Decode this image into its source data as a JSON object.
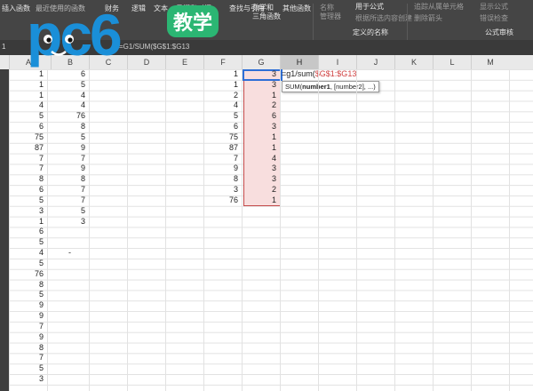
{
  "ribbon": {
    "insert_function": "插入函数",
    "recent": "最近使用的函数",
    "financial": "财务",
    "logical": "逻辑",
    "text": "文本",
    "datetime": "日期和时间",
    "lookup": "查找与引用",
    "math_trig": "数学和\n三角函数",
    "more": "其他函数",
    "name_manager": "名称\n管理器",
    "use_in_formula": "用于公式",
    "create_from_sel": "根据所选内容创建",
    "defined_names_group": "定义的名称",
    "trace_dependents": "追踪从属单元格",
    "remove_arrows": "删除箭头",
    "show_formulas": "显示公式",
    "error_check": "错误检查",
    "formula_audit_group": "公式审核"
  },
  "formula_bar": {
    "name_box": "1",
    "content": "=G1/SUM($G$1:$G13"
  },
  "logo": {
    "text_pc6": "pc6",
    "text_badge": "教学"
  },
  "columns": [
    "A",
    "B",
    "C",
    "D",
    "E",
    "F",
    "G",
    "H",
    "I",
    "J",
    "K",
    "L",
    "M"
  ],
  "selected_column": "H",
  "col_a": [
    "1",
    "1",
    "1",
    "4",
    "5",
    "6",
    "75",
    "87",
    "7",
    "7",
    "8",
    "6",
    "5",
    "3",
    "1",
    "6",
    "5",
    "4",
    "5",
    "76",
    "8",
    "5",
    "9",
    "9",
    "7",
    "9",
    "8",
    "7",
    "5",
    "3"
  ],
  "col_b": [
    "6",
    "5",
    "4",
    "4",
    "76",
    "8",
    "5",
    "9",
    "7",
    "9",
    "8",
    "7",
    "7",
    "5",
    "3"
  ],
  "col_f": [
    "1",
    "1",
    "2",
    "4",
    "5",
    "6",
    "75",
    "87",
    "7",
    "9",
    "8",
    "3",
    "76"
  ],
  "col_g": [
    "3",
    "3",
    "1",
    "2",
    "6",
    "3",
    "1",
    "1",
    "4",
    "3",
    "3",
    "2",
    "1"
  ],
  "dash_cell": "-",
  "edit": {
    "prefix": "=g1/sum(",
    "ref": "$G$1:$G",
    "suffix": "13"
  },
  "tooltip": {
    "func": "SUM(",
    "arg1": "number1",
    "rest": ", [number2], ...)"
  },
  "colors": {
    "ribbon": "#454545",
    "range_fill": "#f8dede",
    "range_border": "#c44a4a",
    "active_border": "#2f6fd6",
    "logo_blue": "#1a8fd8",
    "logo_green": "#2bb673"
  }
}
